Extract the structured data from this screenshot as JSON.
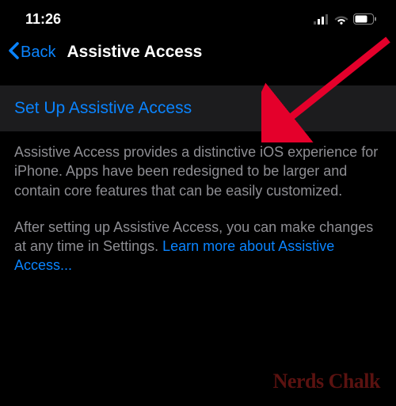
{
  "status_bar": {
    "time": "11:26"
  },
  "nav": {
    "back_label": "Back",
    "title": "Assistive Access"
  },
  "main": {
    "setup_label": "Set Up Assistive Access",
    "paragraph1": "Assistive Access provides a distinctive iOS experience for iPhone. Apps have been redesigned to be larger and contain core features that can be easily customized.",
    "paragraph2": "After setting up Assistive Access, you can make changes at any time in Settings.",
    "learn_more": "Learn more about Assistive Access..."
  },
  "watermark": "Nerds Chalk"
}
